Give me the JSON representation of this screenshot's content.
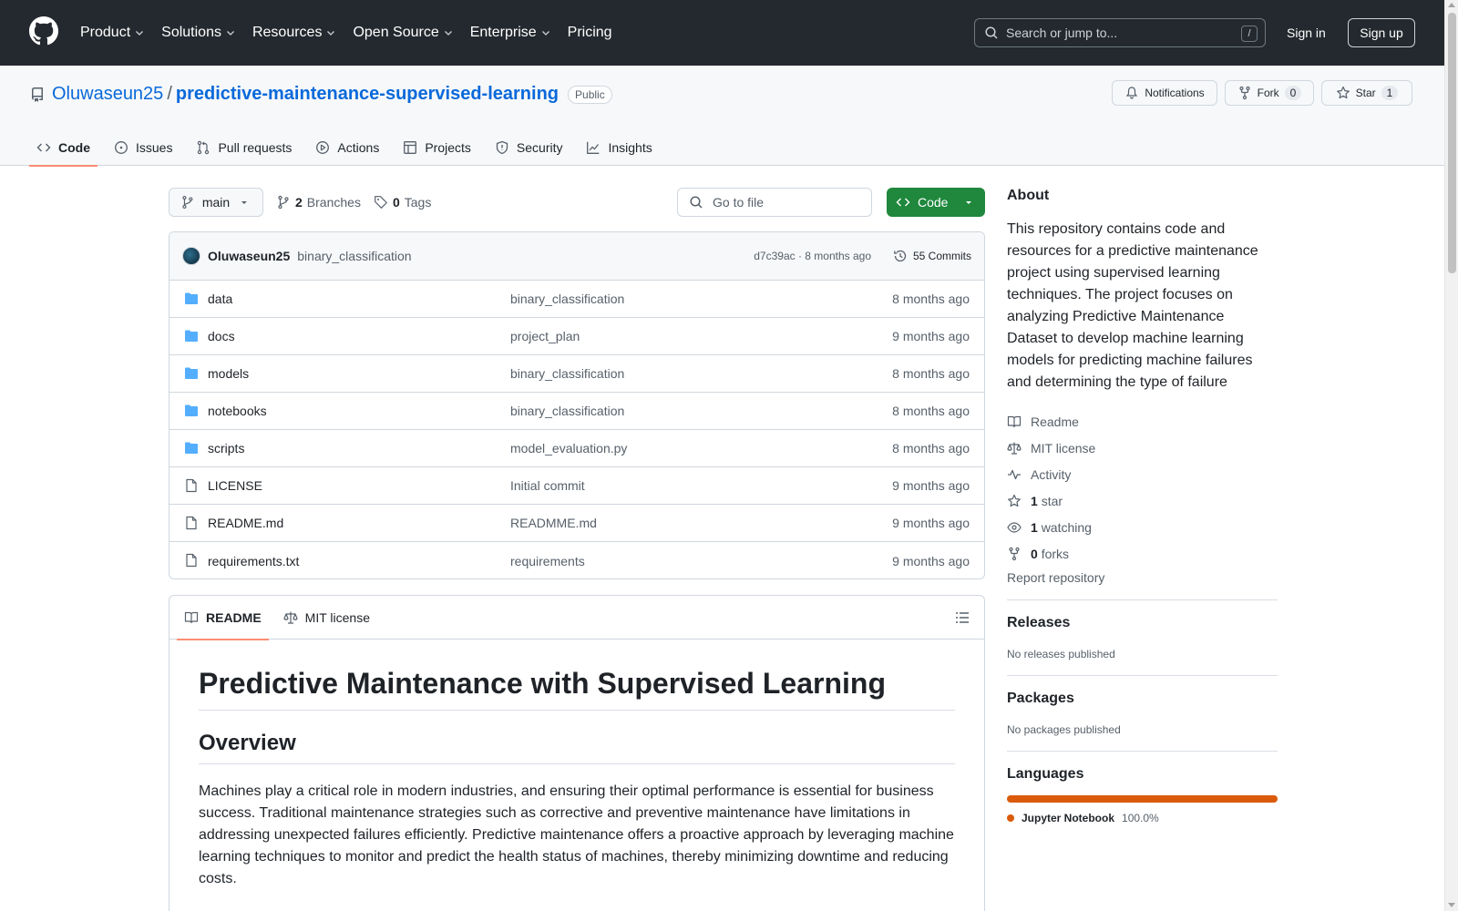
{
  "header": {
    "nav": [
      {
        "label": "Product",
        "dropdown": true
      },
      {
        "label": "Solutions",
        "dropdown": true
      },
      {
        "label": "Resources",
        "dropdown": true
      },
      {
        "label": "Open Source",
        "dropdown": true
      },
      {
        "label": "Enterprise",
        "dropdown": true
      },
      {
        "label": "Pricing",
        "dropdown": false
      }
    ],
    "search_placeholder": "Search or jump to...",
    "search_shortcut": "/",
    "signin": "Sign in",
    "signup": "Sign up"
  },
  "repo": {
    "owner": "Oluwaseun25",
    "separator": "/",
    "name": "predictive-maintenance-supervised-learning",
    "visibility": "Public",
    "notifications_label": "Notifications",
    "fork_label": "Fork",
    "fork_count": "0",
    "star_label": "Star",
    "star_count": "1",
    "tabs": [
      {
        "label": "Code",
        "icon": "code-icon",
        "active": true
      },
      {
        "label": "Issues",
        "icon": "issue-icon",
        "active": false
      },
      {
        "label": "Pull requests",
        "icon": "pull-request-icon",
        "active": false
      },
      {
        "label": "Actions",
        "icon": "play-icon",
        "active": false
      },
      {
        "label": "Projects",
        "icon": "table-icon",
        "active": false
      },
      {
        "label": "Security",
        "icon": "shield-icon",
        "active": false
      },
      {
        "label": "Insights",
        "icon": "graph-icon",
        "active": false
      }
    ]
  },
  "toolbar": {
    "branch": "main",
    "branches_count": "2",
    "branches_label": "Branches",
    "tags_count": "0",
    "tags_label": "Tags",
    "goto_placeholder": "Go to file",
    "code_button": "Code"
  },
  "commit": {
    "author": "Oluwaseun25",
    "message": "binary_classification",
    "meta": "d7c39ac · 8 months ago",
    "count_label": "55 Commits"
  },
  "files": [
    {
      "type": "folder",
      "name": "data",
      "message": "binary_classification",
      "date": "8 months ago"
    },
    {
      "type": "folder",
      "name": "docs",
      "message": "project_plan",
      "date": "9 months ago"
    },
    {
      "type": "folder",
      "name": "models",
      "message": "binary_classification",
      "date": "8 months ago"
    },
    {
      "type": "folder",
      "name": "notebooks",
      "message": "binary_classification",
      "date": "8 months ago"
    },
    {
      "type": "folder",
      "name": "scripts",
      "message": "model_evaluation.py",
      "date": "8 months ago"
    },
    {
      "type": "file",
      "name": "LICENSE",
      "message": "Initial commit",
      "date": "9 months ago"
    },
    {
      "type": "file",
      "name": "README.md",
      "message": "READMME.md",
      "date": "9 months ago"
    },
    {
      "type": "file",
      "name": "requirements.txt",
      "message": "requirements",
      "date": "9 months ago"
    }
  ],
  "readme": {
    "tab_readme": "README",
    "tab_license": "MIT license",
    "h1": "Predictive Maintenance with Supervised Learning",
    "h2": "Overview",
    "paragraph": "Machines play a critical role in modern industries, and ensuring their optimal performance is essential for business success. Traditional maintenance strategies such as corrective and preventive maintenance have limitations in addressing unexpected failures efficiently. Predictive maintenance offers a proactive approach by leveraging machine learning techniques to monitor and predict the health status of machines, thereby minimizing downtime and reducing costs."
  },
  "about": {
    "heading": "About",
    "description": "This repository contains code and resources for a predictive maintenance project using supervised learning techniques. The project focuses on analyzing Predictive Maintenance Dataset to develop machine learning models for predicting machine failures and determining the type of failure",
    "readme": "Readme",
    "license": "MIT license",
    "activity": "Activity",
    "stars_count": "1",
    "stars_label": "star",
    "watching_count": "1",
    "watching_label": "watching",
    "forks_count": "0",
    "forks_label": "forks",
    "report": "Report repository"
  },
  "releases": {
    "heading": "Releases",
    "text": "No releases published"
  },
  "packages": {
    "heading": "Packages",
    "text": "No packages published"
  },
  "languages": {
    "heading": "Languages",
    "items": [
      {
        "name": "Jupyter Notebook",
        "percent": "100.0%",
        "color": "#da5b0b"
      }
    ]
  },
  "colors": {
    "header_bg": "#24292f",
    "link": "#0969da",
    "accent_tab": "#fd8c73",
    "primary_button": "#1f883d",
    "folder": "#54aeff"
  }
}
